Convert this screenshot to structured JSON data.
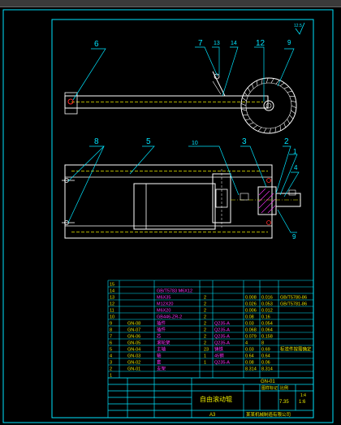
{
  "balloons": {
    "b6": "6",
    "b7": "7",
    "b13": "13",
    "b14": "14",
    "b12": "12",
    "b9a": "9",
    "b8": "8",
    "b5": "5",
    "b10": "10",
    "b3": "3",
    "b2": "2",
    "b1": "1",
    "b4": "4",
    "b9b": "9"
  },
  "surface_mark": "12.5",
  "bom": {
    "rows": [
      {
        "no": "15",
        "code": "",
        "name": "",
        "qty": "",
        "mat": "",
        "w1": "",
        "w2": "",
        "note": ""
      },
      {
        "no": "14",
        "code": "",
        "name": "GB/T5783 M6X12",
        "qty": "",
        "mat": "",
        "w1": "",
        "w2": "",
        "note": ""
      },
      {
        "no": "13",
        "code": "",
        "name": "M6X35",
        "qty": "2",
        "mat": "",
        "w1": "0.008",
        "w2": "0.016",
        "note": "GB/T5780-86"
      },
      {
        "no": "12",
        "code": "",
        "name": "M12X20",
        "qty": "2",
        "mat": "",
        "w1": "0.026",
        "w2": "0.053",
        "note": "GB/T5781-86"
      },
      {
        "no": "11",
        "code": "",
        "name": "M6X20",
        "qty": "2",
        "mat": "",
        "w1": "0.006",
        "w2": "0.012",
        "note": ""
      },
      {
        "no": "10",
        "code": "",
        "name": "GB446-ZR-2",
        "qty": "2",
        "mat": "",
        "w1": "0.08",
        "w2": "0.16",
        "note": ""
      },
      {
        "no": "9",
        "code": "GN-08",
        "name": "插件",
        "qty": "2",
        "mat": "Q235-A",
        "w1": "0.03",
        "w2": "0.054",
        "note": ""
      },
      {
        "no": "8",
        "code": "GN-07",
        "name": "插件",
        "qty": "2",
        "mat": "Q235-A",
        "w1": "0.068",
        "w2": "0.064",
        "note": ""
      },
      {
        "no": "7",
        "code": "GN-06",
        "name": "芯",
        "qty": "2",
        "mat": "Q235-A",
        "w1": "0.079",
        "w2": "0.158",
        "note": ""
      },
      {
        "no": "6",
        "code": "GN-05",
        "name": "滚轮架",
        "qty": "2",
        "mat": "Q235-A",
        "w1": "4",
        "w2": "8",
        "note": ""
      },
      {
        "no": "5",
        "code": "GN-04",
        "name": "主轴",
        "qty": "23",
        "mat": "铸铁",
        "w1": "0.03",
        "w2": "0.69",
        "note": "标准件按需确定"
      },
      {
        "no": "4",
        "code": "GN-03",
        "name": "轴",
        "qty": "1",
        "mat": "45钢",
        "w1": "0.64",
        "w2": "0.64",
        "note": ""
      },
      {
        "no": "3",
        "code": "GN-02",
        "name": "套",
        "qty": "1",
        "mat": "Q235-A",
        "w1": "0.08",
        "w2": "0.06",
        "note": ""
      },
      {
        "no": "2",
        "code": "GN-01",
        "name": "支架",
        "qty": "",
        "mat": "",
        "w1": "8.314",
        "w2": "8.314",
        "note": ""
      },
      {
        "no": "1",
        "code": "",
        "name": "",
        "qty": "",
        "mat": "",
        "w1": "",
        "w2": "",
        "note": ""
      }
    ]
  },
  "title_block": {
    "title": "自由滚动辊",
    "ratio": "1:6",
    "scale_small": "1:4",
    "sheet": "A3",
    "company": "某某机械制造有限公司",
    "code_top": "GN-01",
    "mark": "图样标记",
    "weight": "比例",
    "weight_val": "7.35"
  },
  "colors": {
    "frame": "#00e5ff",
    "line": "#ffffff",
    "yellow": "#e8e800",
    "magenta": "#ff33ff",
    "red": "#ff2a2a"
  }
}
